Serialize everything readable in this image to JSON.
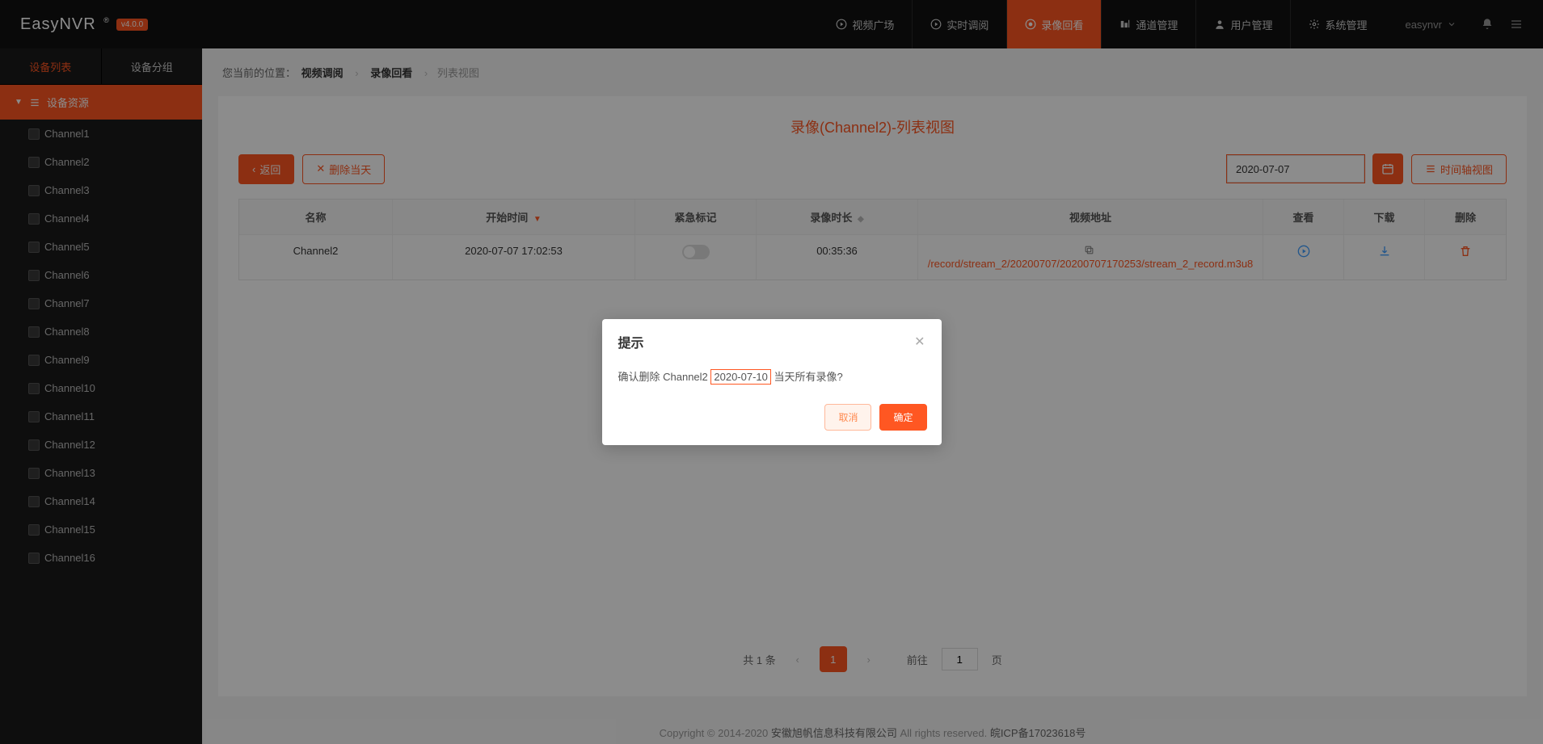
{
  "header": {
    "logo_name": "EasyNVR",
    "logo_reg": "®",
    "version": "v4.0.0",
    "nav": [
      {
        "label": "视频广场"
      },
      {
        "label": "实时调阅"
      },
      {
        "label": "录像回看"
      },
      {
        "label": "通道管理"
      },
      {
        "label": "用户管理"
      },
      {
        "label": "系统管理"
      }
    ],
    "user": "easynvr"
  },
  "sidebar": {
    "tabs": [
      "设备列表",
      "设备分组"
    ],
    "section": "设备资源",
    "channels": [
      "Channel1",
      "Channel2",
      "Channel3",
      "Channel4",
      "Channel5",
      "Channel6",
      "Channel7",
      "Channel8",
      "Channel9",
      "Channel10",
      "Channel11",
      "Channel12",
      "Channel13",
      "Channel14",
      "Channel15",
      "Channel16"
    ]
  },
  "breadcrumb": {
    "label": "您当前的位置：",
    "a": "视频调阅",
    "b": "录像回看",
    "c": "列表视图"
  },
  "page": {
    "title": "录像(Channel2)-列表视图",
    "back_btn": "返回",
    "delete_day_btn": "删除当天",
    "date_value": "2020-07-07",
    "timeline_btn": "时间轴视图"
  },
  "table": {
    "headers": {
      "name": "名称",
      "start": "开始时间",
      "flag": "紧急标记",
      "dur": "录像时长",
      "url": "视频地址",
      "view": "查看",
      "dl": "下载",
      "del": "删除"
    },
    "rows": [
      {
        "name": "Channel2",
        "start": "2020-07-07 17:02:53",
        "dur": "00:35:36",
        "url": "/record/stream_2/20200707/20200707170253/stream_2_record.m3u8"
      }
    ]
  },
  "pagination": {
    "total_label": "共 1 条",
    "current": "1",
    "goto_label_a": "前往",
    "goto_value": "1",
    "goto_label_b": "页"
  },
  "footer": {
    "prefix": "Copyright © 2014-2020 ",
    "company": "安徽旭帆信息科技有限公司",
    "mid": " All rights reserved.",
    "icp": "皖ICP备17023618号"
  },
  "modal": {
    "title": "提示",
    "msg_a": "确认删除 Channel2 ",
    "msg_hl": "2020-07-10",
    "msg_b": " 当天所有录像?",
    "cancel": "取消",
    "ok": "确定"
  }
}
